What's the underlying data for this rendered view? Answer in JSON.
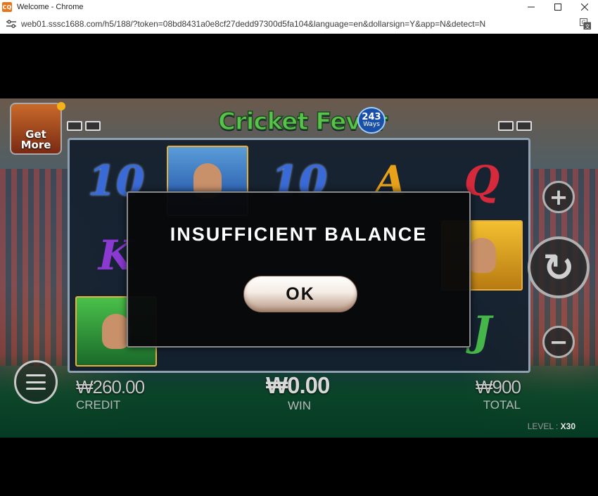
{
  "window": {
    "title": "Welcome - Chrome",
    "app_icon_text": "CQ",
    "controls": [
      "minimize-icon",
      "maximize-icon",
      "close-icon"
    ]
  },
  "addressbar": {
    "url": "web01.sssc1688.com/h5/188/?token=08bd8431a0e8cf27dedd97300d5fa104&language=en&dollarsign=Y&app=N&detect=N",
    "left_icon": "site-settings-icon",
    "right_icon": "translate-icon"
  },
  "game": {
    "logo": {
      "title": "Cricket Fever",
      "badge_number": "243",
      "badge_label": "Ways"
    },
    "get_more": {
      "line1": "Get",
      "line2": "More"
    },
    "reels": [
      [
        "10",
        "K",
        "batsman"
      ],
      [
        "bowler",
        "",
        ""
      ],
      [
        "10",
        "",
        ""
      ],
      [
        "A",
        "",
        ""
      ],
      [
        "Q",
        "captain",
        "J"
      ]
    ],
    "buttons": {
      "plus": "+",
      "minus": "−",
      "spin": "↻"
    },
    "stats": {
      "credit": {
        "value": "₩260.00",
        "label": "CREDIT"
      },
      "win": {
        "value": "₩0.00",
        "label": "WIN"
      },
      "total": {
        "value": "₩900",
        "label": "TOTAL"
      }
    },
    "level": {
      "label": "LEVEL :",
      "value": "X30"
    }
  },
  "modal": {
    "title": "INSUFFICIENT BALANCE",
    "ok_label": "OK"
  }
}
